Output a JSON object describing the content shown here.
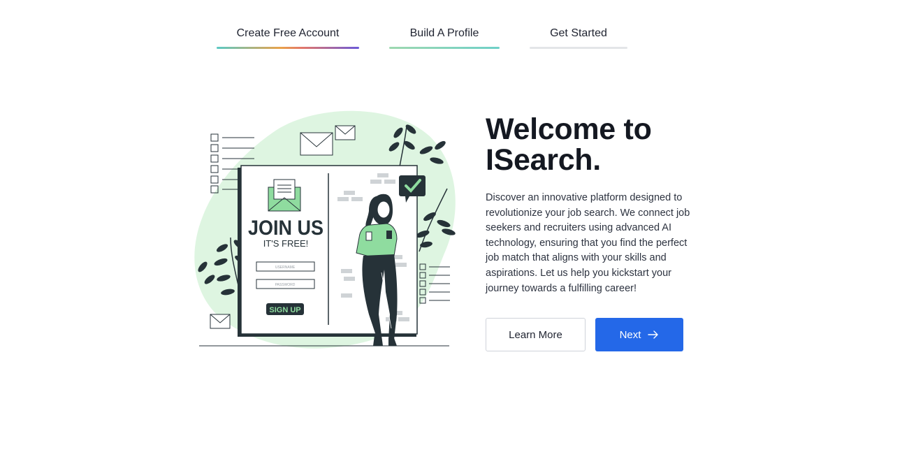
{
  "steps": [
    {
      "label": "Create Free Account",
      "active": true
    },
    {
      "label": "Build A Profile",
      "active": true
    },
    {
      "label": "Get Started",
      "active": false
    }
  ],
  "hero": {
    "title_line1": "Welcome to",
    "title_line2": "ISearch.",
    "description": "Discover an innovative platform designed to revolutionize your job search. We connect job seekers and recruiters using advanced AI technology, ensuring that you find the perfect job match that aligns with your skills and aspirations. Let us help you kickstart your journey towards a fulfilling career!"
  },
  "buttons": {
    "learn_more": "Learn More",
    "next": "Next"
  },
  "illustration": {
    "join_us": "JOIN US",
    "its_free": "IT'S FREE!",
    "username": "USERNAME",
    "password": "PASSWORD",
    "sign_up": "SIGN UP"
  },
  "colors": {
    "accent": "#2468e8",
    "illustration_green": "#8fdc9f",
    "blob": "#def5e1",
    "dark": "#263238"
  }
}
